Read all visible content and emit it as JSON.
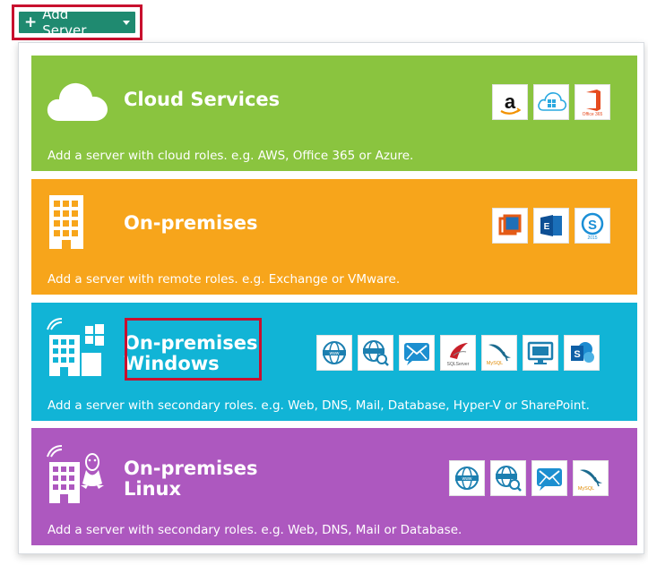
{
  "add_server": {
    "label": "Add Server"
  },
  "cards": {
    "cloud": {
      "title": "Cloud Services",
      "desc": "Add a server with cloud roles. e.g. AWS, Office 365 or Azure.",
      "tiles": [
        "amazon-icon",
        "azure-icon",
        "office-365-icon"
      ]
    },
    "onprem": {
      "title": "On-premises",
      "desc": "Add a server with remote roles. e.g. Exchange or VMware.",
      "tiles": [
        "vmware-icon",
        "exchange-icon",
        "skype-icon"
      ]
    },
    "windows": {
      "title_line1": "On-premises",
      "title_line2": "Windows",
      "desc": "Add a server with secondary roles. e.g. Web, DNS, Mail, Database, Hyper-V or SharePoint.",
      "tiles": [
        "web-icon",
        "dns-icon",
        "mail-icon",
        "sqlserver-icon",
        "mysql-icon",
        "hyperv-icon",
        "sharepoint-icon"
      ]
    },
    "linux": {
      "title_line1": "On-premises",
      "title_line2": "Linux",
      "desc": "Add a server with secondary roles. e.g. Web, DNS, Mail or Database.",
      "tiles": [
        "web-icon",
        "dns-icon",
        "mail-icon",
        "mysql-icon"
      ]
    }
  },
  "colors": {
    "cloud": "#8ac43f",
    "onprem": "#f7a51b",
    "windows": "#11b4d6",
    "linux": "#ad58bf",
    "button": "#1f8a70",
    "highlight": "#c8102e"
  }
}
